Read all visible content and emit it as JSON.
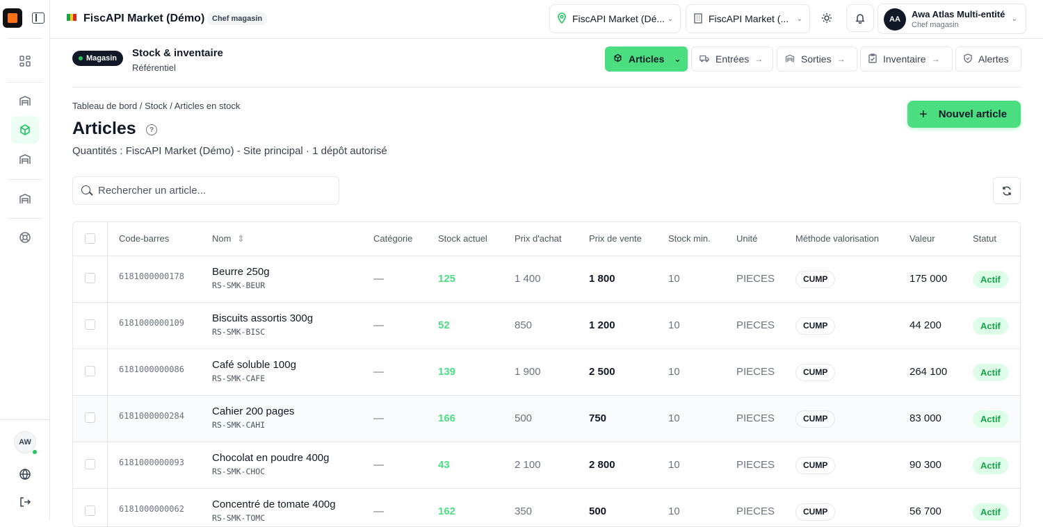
{
  "header": {
    "app_title": "FiscAPI Market (Démo)",
    "role": "Chef magasin",
    "location_select": "FiscAPI Market (Dé...",
    "entity_select": "FiscAPI Market (...",
    "user": {
      "initials": "AA",
      "name": "Awa Atlas Multi-entité",
      "role": "Chef magasin"
    }
  },
  "sidebar": {
    "user_initials": "AW"
  },
  "subheader": {
    "badge": "Magasin",
    "title": "Stock & inventaire",
    "subtitle": "Référentiel",
    "tabs": [
      {
        "label": "Articles"
      },
      {
        "label": "Entrées"
      },
      {
        "label": "Sorties"
      },
      {
        "label": "Inventaire"
      },
      {
        "label": "Alertes"
      }
    ]
  },
  "page": {
    "breadcrumb": "Tableau de bord / Stock / Articles en stock",
    "title": "Articles",
    "subtitle": "Quantités : FiscAPI Market (Démo) - Site principal · 1 dépôt autorisé",
    "new_button": "Nouvel article",
    "search_placeholder": "Rechercher un article..."
  },
  "table": {
    "columns": [
      "Code-barres",
      "Nom",
      "Catégorie",
      "Stock actuel",
      "Prix d'achat",
      "Prix de vente",
      "Stock min.",
      "Unité",
      "Méthode valorisation",
      "Valeur",
      "Statut"
    ],
    "rows": [
      {
        "barcode": "6181000000178",
        "name": "Beurre 250g",
        "ref": "RS-SMK-BEUR",
        "category": "—",
        "stock": "125",
        "buy": "1 400",
        "sell": "1 800",
        "min": "10",
        "unit": "PIECES",
        "method": "CUMP",
        "value": "175 000",
        "status": "Actif"
      },
      {
        "barcode": "6181000000109",
        "name": "Biscuits assortis 300g",
        "ref": "RS-SMK-BISC",
        "category": "—",
        "stock": "52",
        "buy": "850",
        "sell": "1 200",
        "min": "10",
        "unit": "PIECES",
        "method": "CUMP",
        "value": "44 200",
        "status": "Actif"
      },
      {
        "barcode": "6181000000086",
        "name": "Café soluble 100g",
        "ref": "RS-SMK-CAFE",
        "category": "—",
        "stock": "139",
        "buy": "1 900",
        "sell": "2 500",
        "min": "10",
        "unit": "PIECES",
        "method": "CUMP",
        "value": "264 100",
        "status": "Actif"
      },
      {
        "barcode": "6181000000284",
        "name": "Cahier 200 pages",
        "ref": "RS-SMK-CAHI",
        "category": "—",
        "stock": "166",
        "buy": "500",
        "sell": "750",
        "min": "10",
        "unit": "PIECES",
        "method": "CUMP",
        "value": "83 000",
        "status": "Actif"
      },
      {
        "barcode": "6181000000093",
        "name": "Chocolat en poudre 400g",
        "ref": "RS-SMK-CHOC",
        "category": "—",
        "stock": "43",
        "buy": "2 100",
        "sell": "2 800",
        "min": "10",
        "unit": "PIECES",
        "method": "CUMP",
        "value": "90 300",
        "status": "Actif"
      },
      {
        "barcode": "6181000000062",
        "name": "Concentré de tomate 400g",
        "ref": "RS-SMK-TOMC",
        "category": "—",
        "stock": "162",
        "buy": "350",
        "sell": "500",
        "min": "10",
        "unit": "PIECES",
        "method": "CUMP",
        "value": "56 700",
        "status": "Actif"
      }
    ]
  },
  "colors": {
    "accent": "#4ade80",
    "stock_text": "#4ade80",
    "status_bg": "#dcfce7",
    "status_text": "#16a34a"
  }
}
